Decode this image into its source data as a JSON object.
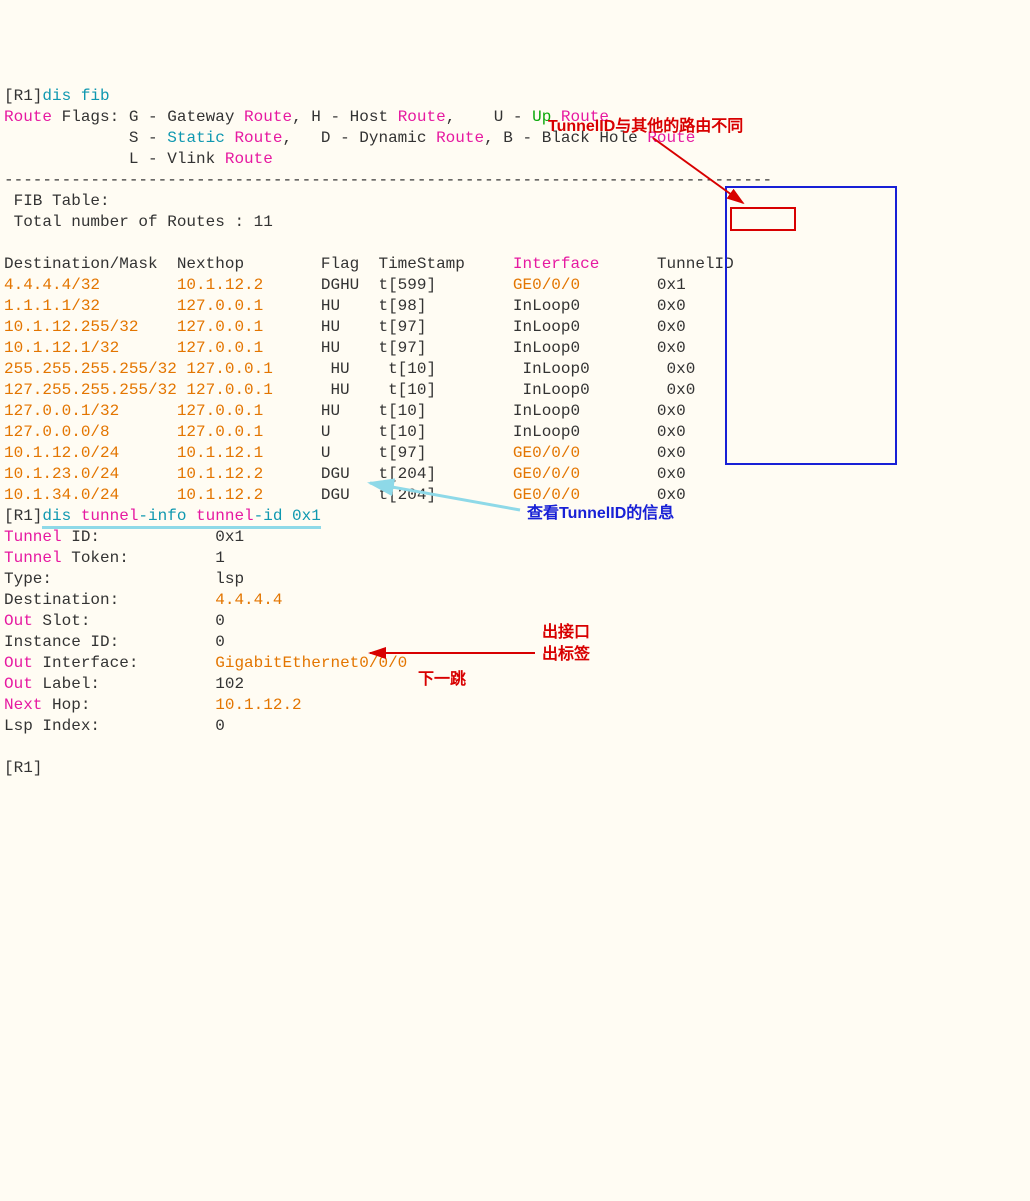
{
  "cmd1": {
    "prompt": "[R1]",
    "cmd": "dis fib"
  },
  "flags_header": "Route",
  "flags_word": " Flags: ",
  "flags": {
    "g": "G - Gateway ",
    "route": "Route",
    "comma": ", ",
    "h": "H - Host ",
    "u": "U - ",
    "up": "Up",
    "up_route": " Route",
    "s": "S - ",
    "static": "Static",
    "static_route": " Route",
    "comma2": ",   ",
    "d": "D - Dynamic ",
    "b": "B - Black Hole ",
    "l": "L - Vlink "
  },
  "sep": "--------------------------------------------------------------------------------",
  "fib_table": " FIB Table:",
  "total": " Total number of Routes : 11",
  "hdr": {
    "dest": "Destination/Mask  ",
    "nh": "Nexthop        ",
    "flag": "Flag  ",
    "ts": "TimeStamp     ",
    "intf": "Interface",
    "tid": "      TunnelID"
  },
  "rows": [
    {
      "d": "4.4.4.4/32        ",
      "n": "10.1.12.2      ",
      "f": "DGHU  ",
      "t": "t[599]        ",
      "i": "GE0/0/0        ",
      "x": "0x1"
    },
    {
      "d": "1.1.1.1/32        ",
      "n": "127.0.0.1      ",
      "f": "HU    ",
      "t": "t[98]         ",
      "i": "InLoop0        ",
      "x": "0x0"
    },
    {
      "d": "10.1.12.255/32    ",
      "n": "127.0.0.1      ",
      "f": "HU    ",
      "t": "t[97]         ",
      "i": "InLoop0        ",
      "x": "0x0"
    },
    {
      "d": "10.1.12.1/32      ",
      "n": "127.0.0.1      ",
      "f": "HU    ",
      "t": "t[97]         ",
      "i": "InLoop0        ",
      "x": "0x0"
    },
    {
      "d": "255.255.255.255/32",
      "n": " 127.0.0.1      ",
      "f": "HU    ",
      "t": "t[10]         ",
      "i": "InLoop0        ",
      "x": "0x0"
    },
    {
      "d": "127.255.255.255/32",
      "n": " 127.0.0.1      ",
      "f": "HU    ",
      "t": "t[10]         ",
      "i": "InLoop0        ",
      "x": "0x0"
    },
    {
      "d": "127.0.0.1/32      ",
      "n": "127.0.0.1      ",
      "f": "HU    ",
      "t": "t[10]         ",
      "i": "InLoop0        ",
      "x": "0x0"
    },
    {
      "d": "127.0.0.0/8       ",
      "n": "127.0.0.1      ",
      "f": "U     ",
      "t": "t[10]         ",
      "i": "InLoop0        ",
      "x": "0x0"
    },
    {
      "d": "10.1.12.0/24      ",
      "n": "10.1.12.1      ",
      "f": "U     ",
      "t": "t[97]         ",
      "i": "GE0/0/0        ",
      "x": "0x0"
    },
    {
      "d": "10.1.23.0/24      ",
      "n": "10.1.12.2      ",
      "f": "DGU   ",
      "t": "t[204]        ",
      "i": "GE0/0/0        ",
      "x": "0x0"
    },
    {
      "d": "10.1.34.0/24      ",
      "n": "10.1.12.2      ",
      "f": "DGU   ",
      "t": "t[204]        ",
      "i": "GE0/0/0        ",
      "x": "0x0"
    }
  ],
  "cmd2": {
    "prompt": "[R1]",
    "pre": "dis ",
    "w1": "tunnel",
    "mid": "-info ",
    "w2": "tunnel",
    "end": "-id 0x1"
  },
  "tinfo": [
    {
      "k1": "Tunnel",
      "k2": " ID:            ",
      "v": "0x1"
    },
    {
      "k1": "Tunnel",
      "k2": " Token:         ",
      "v": "1"
    },
    {
      "k1": "Type:",
      "k2": "                 ",
      "v": "lsp"
    },
    {
      "k1": "Destination:",
      "k2": "          ",
      "v": "4.4.4.4"
    },
    {
      "k1": "Out",
      "k2": " Slot:             ",
      "v": "0"
    },
    {
      "k1": "Instance ID:",
      "k2": "          ",
      "v": "0"
    },
    {
      "k1": "Out",
      "k2": " Interface:        ",
      "v": "GigabitEthernet0/0/0"
    },
    {
      "k1": "Out",
      "k2": " Label:            ",
      "v": "102"
    },
    {
      "k1": "Next",
      "k2": " Hop:             ",
      "v": "10.1.12.2"
    },
    {
      "k1": "Lsp",
      "k2": " Index:            ",
      "v": "0"
    }
  ],
  "prompt_end": "[R1]",
  "annotations": {
    "tunnelid_diff": "TunnelID与其他的路由不同",
    "view_tunnelid": "查看TunnelID的信息",
    "out_interface": "出接口",
    "out_label": "出标签",
    "next_hop": "下一跳"
  }
}
